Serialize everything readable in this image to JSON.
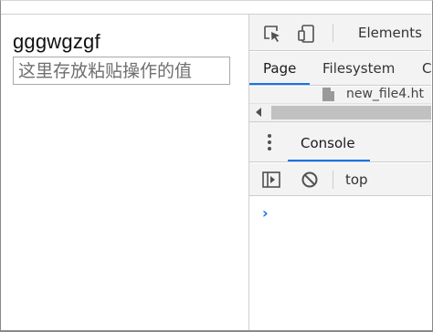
{
  "page": {
    "text": "gggwgzgf",
    "paste_input": {
      "value": "",
      "placeholder": "这里存放粘贴操作的值"
    }
  },
  "devtools": {
    "toolbar": {
      "inspect_icon": "inspect-element-icon",
      "device_icon": "device-toolbar-icon",
      "elements_label": "Elements"
    },
    "sources_tabs": [
      {
        "label": "Page",
        "active": true
      },
      {
        "label": "Filesystem",
        "active": false
      },
      {
        "label": "C",
        "active": false
      }
    ],
    "file_tree": {
      "file_name": "new_file4.ht"
    },
    "drawer": {
      "menu_icon": "more-vertical-icon",
      "tab_label": "Console"
    },
    "console_toolbar": {
      "sidebar_icon": "show-sidebar-icon",
      "clear_icon": "clear-console-icon",
      "context": "top"
    },
    "console": {
      "prompt": "›"
    },
    "accent_color": "#1a73e8"
  }
}
